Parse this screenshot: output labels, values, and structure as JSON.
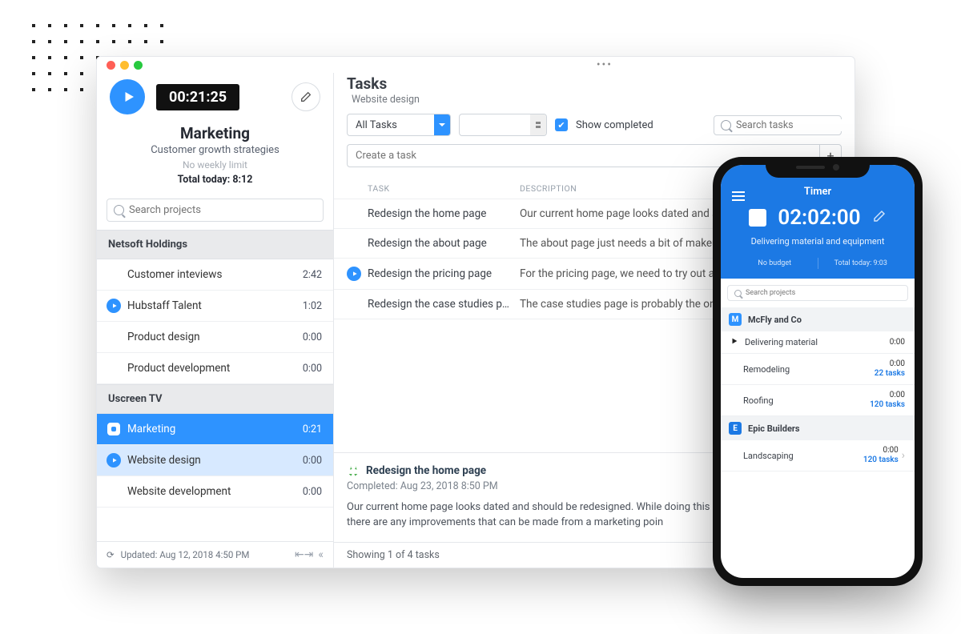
{
  "desktop": {
    "timer": "00:21:25",
    "project": {
      "name": "Marketing",
      "subtitle": "Customer growth strategies",
      "limit": "No weekly limit",
      "total_today": "Total today: 8:12"
    },
    "search_placeholder": "Search projects",
    "orgs": [
      {
        "name": "Netsoft Holdings",
        "projects": [
          {
            "name": "Customer inteviews",
            "time": "2:42",
            "icon": ""
          },
          {
            "name": "Hubstaff Talent",
            "time": "1:02",
            "icon": "play"
          },
          {
            "name": "Product design",
            "time": "0:00",
            "icon": ""
          },
          {
            "name": "Product development",
            "time": "0:00",
            "icon": ""
          }
        ]
      },
      {
        "name": "Uscreen TV",
        "projects": [
          {
            "name": "Marketing",
            "time": "0:21",
            "icon": "stop",
            "state": "sel"
          },
          {
            "name": "Website design",
            "time": "0:00",
            "icon": "play",
            "state": "alt"
          },
          {
            "name": "Website development",
            "time": "0:00",
            "icon": ""
          }
        ]
      }
    ],
    "footer": {
      "updated": "Updated: Aug 12, 2018 4:50 PM"
    }
  },
  "tasks": {
    "title": "Tasks",
    "crumb": "Website design",
    "filter_value": "All Tasks",
    "show_completed_label": "Show completed",
    "search_placeholder": "Search tasks",
    "create_placeholder": "Create a task",
    "columns": {
      "task": "TASK",
      "desc": "DESCRIPTION"
    },
    "rows": [
      {
        "name": "Redesign the home page",
        "desc": "Our current home page looks dated and should…",
        "icon": ""
      },
      {
        "name": "Redesign the about page",
        "desc": "The about page just needs a bit of makeup, bec…",
        "icon": ""
      },
      {
        "name": "Redesign the pricing page",
        "desc": "For the pricing page, we need to try out a differ…",
        "icon": "play"
      },
      {
        "name": "Redesign the case studies pa…",
        "desc": "The case studies page is probably the one that …",
        "icon": ""
      }
    ],
    "detail": {
      "title": "Redesign the home page",
      "completed": "Completed: Aug 23, 2018 8:50 PM",
      "body": "Our current home page looks dated and should be redesigned. While doing this we can section and see if there are any improvements that can be made from a marketing poin"
    },
    "footer": "Showing 1 of 4 tasks"
  },
  "mobile": {
    "title": "Timer",
    "time": "02:02:00",
    "subtitle": "Delivering material and equipment",
    "meta": {
      "left": "No budget",
      "right": "Total today: 9:03"
    },
    "search_placeholder": "Search projects",
    "orgs": [
      {
        "name": "McFly and Co",
        "badge": "M",
        "color": "#2e93ff",
        "items": [
          {
            "name": "Delivering material",
            "time": "0:00",
            "tasks": "",
            "icon": "play"
          },
          {
            "name": "Remodeling",
            "time": "0:00",
            "tasks": "22 tasks"
          },
          {
            "name": "Roofing",
            "time": "0:00",
            "tasks": "120 tasks"
          }
        ]
      },
      {
        "name": "Epic Builders",
        "badge": "E",
        "color": "#1c79e4",
        "items": [
          {
            "name": "Landscaping",
            "time": "0:00",
            "tasks": "120 tasks",
            "chev": true
          }
        ]
      }
    ]
  }
}
